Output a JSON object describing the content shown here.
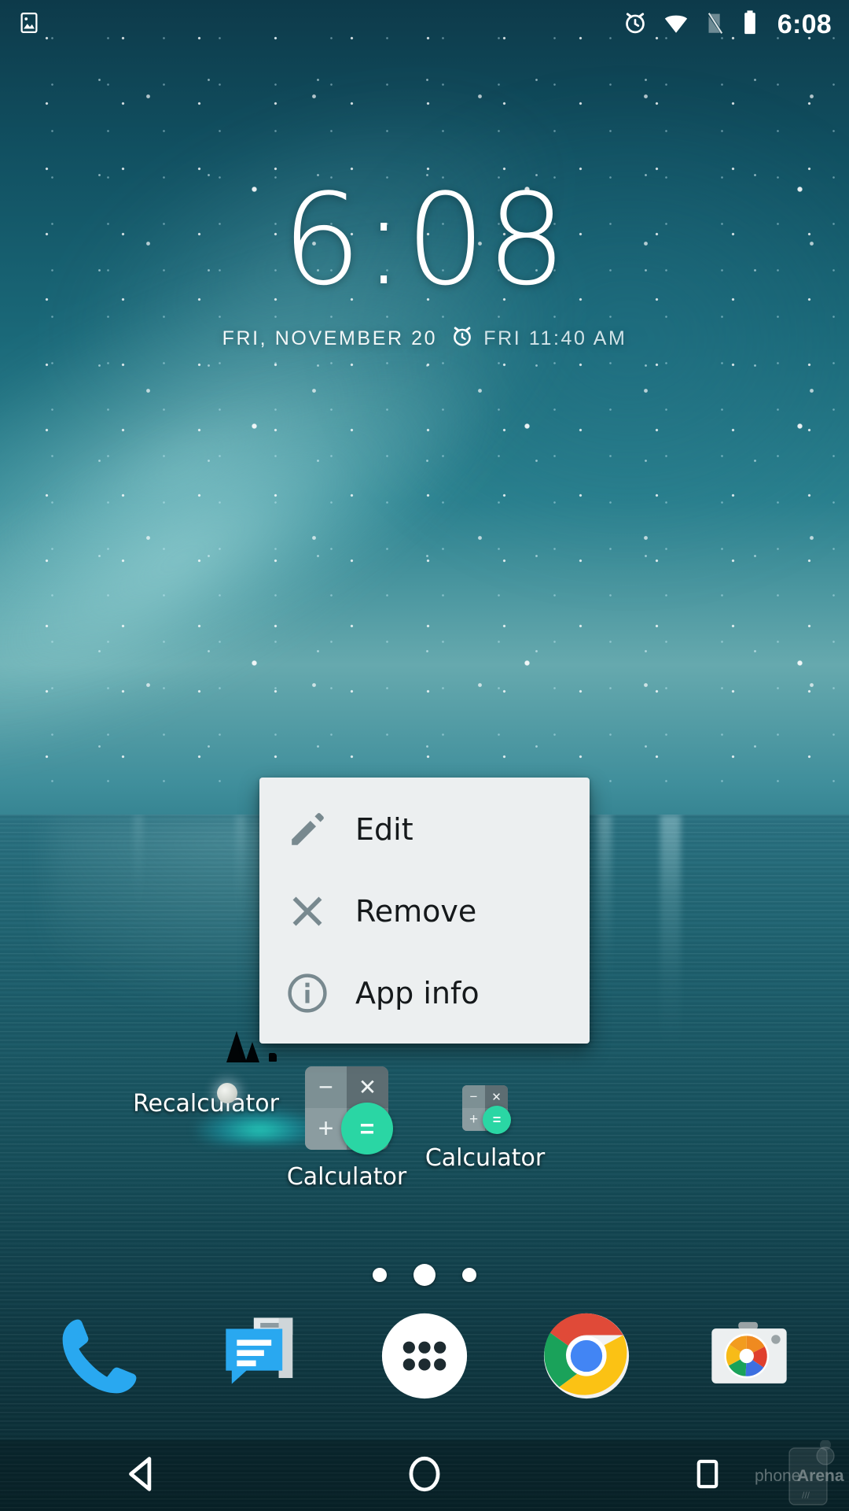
{
  "statusbar": {
    "left_icons": [
      {
        "name": "screenshot-icon",
        "label": "screenshot"
      }
    ],
    "right_icons": [
      {
        "name": "alarm-icon",
        "label": "alarm set"
      },
      {
        "name": "wifi-icon",
        "label": "wifi full"
      },
      {
        "name": "signal-off-icon",
        "label": "no sim signal"
      },
      {
        "name": "battery-icon",
        "label": "battery full"
      }
    ],
    "clock": "6:08"
  },
  "clock_widget": {
    "time": "6:08",
    "date": "FRI, NOVEMBER 20",
    "alarm_icon": "alarm-clock-icon",
    "next_alarm": "FRI 11:40 AM"
  },
  "popup_menu": {
    "items": [
      {
        "icon": "pencil-icon",
        "label": "Edit"
      },
      {
        "icon": "close-x-icon",
        "label": "Remove"
      },
      {
        "icon": "info-circle-icon",
        "label": "App info"
      }
    ]
  },
  "home_icons": [
    {
      "label": "Recalculator",
      "icon": "recalculator-icon"
    },
    {
      "label": "Calculator",
      "icon": "calculator-icon"
    },
    {
      "label": "Calculator",
      "icon": "calculator-icon-small"
    }
  ],
  "page_indicator": {
    "count": 3,
    "active_index": 1
  },
  "dock": [
    {
      "name": "phone-icon",
      "label": "Phone"
    },
    {
      "name": "messaging-icon",
      "label": "Messaging"
    },
    {
      "name": "app-drawer-icon",
      "label": "Apps"
    },
    {
      "name": "chrome-icon",
      "label": "Chrome"
    },
    {
      "name": "camera-icon",
      "label": "Camera"
    }
  ],
  "navbar": [
    {
      "name": "back-button",
      "label": "Back"
    },
    {
      "name": "home-button",
      "label": "Home"
    },
    {
      "name": "recents-button",
      "label": "Recents"
    }
  ],
  "watermark": {
    "text_light": "phone",
    "text_bold": "Arena"
  },
  "colors": {
    "accent_green": "#2ad6a4",
    "menu_bg": "#eceff0",
    "menu_text": "#15191b",
    "menu_icon": "#78898f",
    "status_white": "#ffffff",
    "dock_blue": "#2196f3"
  }
}
